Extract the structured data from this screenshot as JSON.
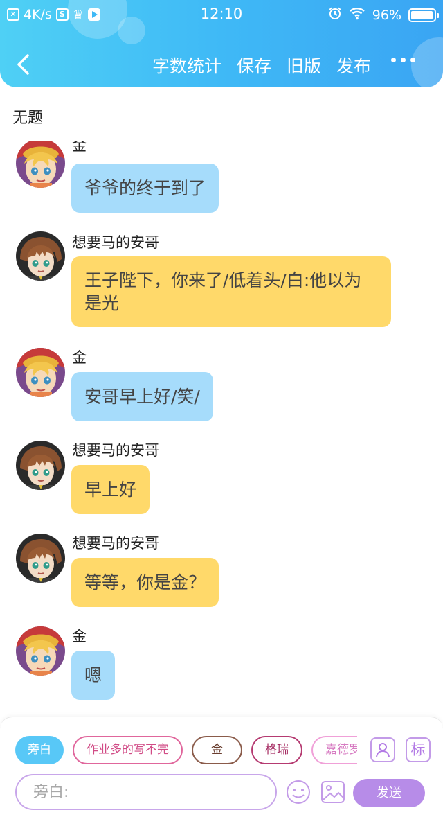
{
  "status_bar": {
    "speed": "4K/s",
    "time": "12:10",
    "battery": "96%",
    "battery_level": 0.96
  },
  "nav": {
    "actions": [
      "字数统计",
      "保存",
      "旧版",
      "发布"
    ]
  },
  "story": {
    "title": "无题"
  },
  "messages": [
    {
      "sender": "金",
      "text": "爷爷的终于到了",
      "color": "blue",
      "avatar": "blonde-boy-avatar"
    },
    {
      "sender": "想要马的安哥",
      "text": "王子陛下，你来了/低着头/白:他以为是光",
      "color": "yellow",
      "avatar": "brown-hair-avatar"
    },
    {
      "sender": "金",
      "text": "安哥早上好/笑/",
      "color": "blue",
      "avatar": "blonde-boy-avatar"
    },
    {
      "sender": "想要马的安哥",
      "text": "早上好",
      "color": "yellow",
      "avatar": "brown-hair-avatar"
    },
    {
      "sender": "想要马的安哥",
      "text": "等等，你是金？",
      "color": "yellow",
      "avatar": "brown-hair-avatar"
    },
    {
      "sender": "金",
      "text": "嗯",
      "color": "blue",
      "avatar": "blonde-boy-avatar"
    }
  ],
  "roles": [
    "旁白",
    "作业多的写不完",
    "金",
    "格瑞",
    "嘉德罗斯"
  ],
  "side_buttons": {
    "tag_label": "标"
  },
  "input": {
    "placeholder": "旁白:",
    "send_label": "发送"
  },
  "colors": {
    "header_gradient": [
      "#4fd0f5",
      "#3aa5f3"
    ],
    "blue_bubble": "#a6dcfb",
    "yellow_bubble": "#ffd96a",
    "send_button": "#b78ce8",
    "active_chip": "#58c8f7"
  }
}
